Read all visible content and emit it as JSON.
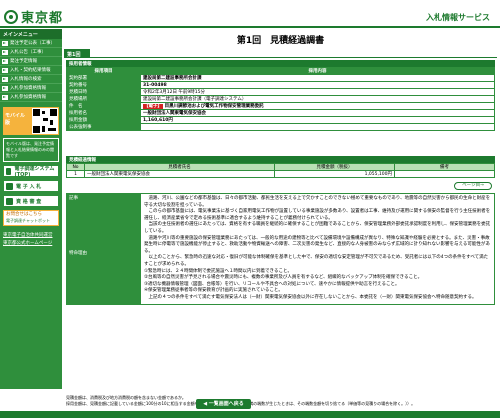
{
  "header": {
    "logo_text": "東京都",
    "system_name": "入札情報サービス"
  },
  "sidebar": {
    "heading": "メインメニュー",
    "items": [
      {
        "label": "発注予定公表（工事）"
      },
      {
        "label": "入札公告（工事）"
      },
      {
        "label": "発注予定情報"
      },
      {
        "label": "入札・契約結果情報"
      },
      {
        "label": "入札情報の検索"
      },
      {
        "label": "入札参加資格情報"
      },
      {
        "label": "入札参加資格情報"
      }
    ],
    "mobile_label": "モバイル版",
    "mobile_note": "モバイル版は、発注予定情報と入札結果情報のみの閲覧です",
    "buttons": [
      {
        "label": "電子調達システム(TOP)"
      },
      {
        "label": "電 子 入 札"
      },
      {
        "label": "資 格 審 査"
      }
    ],
    "helpdesk_title": "お問合せはこちら",
    "helpdesk_sub": "電子調達チャットボット",
    "links": [
      {
        "label": "東京電子自治体共同運営"
      },
      {
        "label": "東京都公式ホームページ"
      }
    ]
  },
  "main": {
    "title": "第1回　見積経過調書",
    "tab": "第1回",
    "sections": {
      "info_head": "採用者情報",
      "progress_head": "見積経過情報",
      "remarks_head": "記事"
    },
    "info_table": {
      "header_label": "採用項目",
      "header_value": "採用内容",
      "rows": [
        {
          "label": "契約部署",
          "value": "建設局第二建設事務所会計課"
        },
        {
          "label": "契約番号",
          "value": "31-00498"
        },
        {
          "label": "見積日時",
          "value": "令和2年3月12日 午前9時15分"
        },
        {
          "label": "見積場所",
          "value": "建設局第二建設事務所会計課（電子調達システム）"
        },
        {
          "label": "件　名",
          "tag": "【電子】",
          "value": "目黒川調節池および電気工作物保安管理業務委託"
        },
        {
          "label": "採用者名",
          "value": "一般財団法人関東電気保安協会"
        },
        {
          "label": "採用金額",
          "value": "1,160,610円"
        },
        {
          "label": "公表強制事",
          "value": ""
        }
      ]
    },
    "progress_table": {
      "headers": [
        "No",
        "見積者氏名",
        "見積金額（税抜）",
        "備考"
      ],
      "rows": [
        {
          "no": "1",
          "name": "一般財団法人関東電気保安協会",
          "amount": "1,055,100円",
          "note": ""
        }
      ]
    },
    "history_button": "ページ目→",
    "remarks": {
      "label_top": "記事",
      "label_mid": "特命理由",
      "text": "　道路、河川、公園などの都市基盤は、日々の都市活動、都民生活を支える上で欠かすことのできない極めて重要なものであり、地震等の自然災害から都民の生命と財産を守る大切な役割を担っている。\n　このらの都市基盤には、電気事業法に基づく自家用電気工作物が設置している事業施設が多数あり、設置者は工事、維持及び運用に関する保安の監督を行う主任技術者を選任し、経済産業省令で定める技術基準に適合するよう維持することが義務付けられている。\n　当該の主任技術者の選任にあたっては、資格を有する職員を継続的に確保することが困難であることから、保安管理業務外部委託承認制度を利用し、保安管理業務を委託している。\n　道路や河川等の重要施設の保安管理業務にあたっては、一般的な用途の建物等と比べて設備環境や設備構成が異なり、特殊な知識や経験を必要とする。また、災害・事故発生時に停電等で施設機能が停止すると、救助活動や物資輸送への障害、二次災害の発生など、直接的な人身被害のみならず広域的に計り知れない影響を与える可能性がある。\n　以上のことから、緊急時の迅速な対応・復旧が可能な体制確保を基準とした中で、保安の適切な安定管理が不可欠であるため、受託者には以下の4つの条件をすべて満たすことが求められる。\n①緊急時には、２４時間体制で委託施設へ１時間以内に到着できること。\n②台風等の自然災害が予見される場合や震災時にも、複数の事業所及び人員を有するなど、組織的なバックアップ体制を確保できること。\n③適切な機器情報管理（図面、台帳等）を行い、リコールや不具合への対処について、速やかに情報提供や助言を行えること。\n④保安管理業務従事者等の保安教育が計画的に実施されていること。\n　上記の４つの条件をすべて満たす電気保安法人は（一財）関東電気保安協会以外に存在しないことから、本委託を（一財）関東電気保安協会へ特命随意契約する。"
    },
    "footnotes": [
      "見積金額は、消費税及び地方消費税の額を含まない金額であるか。",
      "採用金額は、見積金額に記載している金額に100分の10に相当する金額を加算したものである（1円未満の端数が生じたときは、その端数金額を切り捨てる〔単価等の見積りの場合を除く。〕）。"
    ],
    "back_button": "◀ 一覧画面へ戻る"
  }
}
